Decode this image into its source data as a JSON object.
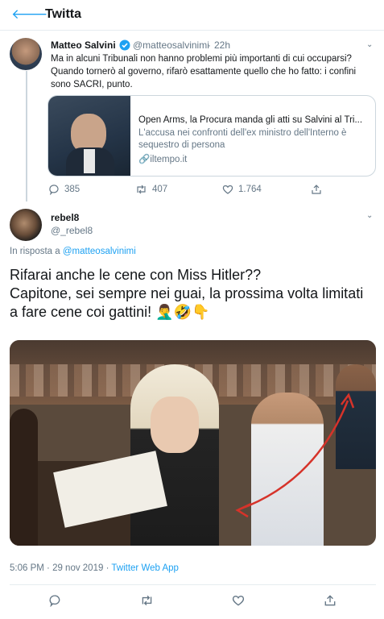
{
  "header": {
    "title": "Twitta"
  },
  "tweet1": {
    "author_name": "Matteo Salvini",
    "author_handle": "@matteosalvinimi",
    "time": "22h",
    "text_line1": "Ma in alcuni Tribunali non hanno problemi più importanti di cui occuparsi?",
    "text_line2": "Quando tornerò al governo, rifarò esattamente quello che ho fatto: i confini",
    "text_line3": "sono SACRI, punto.",
    "card": {
      "title": "Open Arms, la Procura manda gli atti su Salvini al Tri...",
      "description": "L'accusa nei confronti dell'ex ministro dell'Interno è sequestro di persona",
      "domain": "iltempo.it"
    },
    "stats": {
      "replies": "385",
      "retweets": "407",
      "likes": "1.764"
    }
  },
  "tweet2": {
    "author_name": "rebel8",
    "author_handle": "@_rebel8",
    "reply_prefix": "In risposta a",
    "reply_handle": "@matteosalvinimi",
    "text_line1": "Rifarai anche le cene con Miss Hitler??",
    "text_line2": "Capitone, sei sempre nei guai, la prossima volta limitati",
    "text_line3": "a fare cene coi gattini!",
    "emojis": "🤦‍♂️🤣👇",
    "time": "5:06 PM",
    "date": "29 nov 2019",
    "app": "Twitter Web App"
  },
  "colors": {
    "accent": "#1da1f2",
    "muted": "#657786",
    "border": "#e6ecf0",
    "arrow": "#d6332a"
  },
  "icons": [
    "back-arrow-icon",
    "verified-badge-icon",
    "chevron-down-icon",
    "link-icon",
    "reply-icon",
    "retweet-icon",
    "like-icon",
    "share-icon"
  ]
}
